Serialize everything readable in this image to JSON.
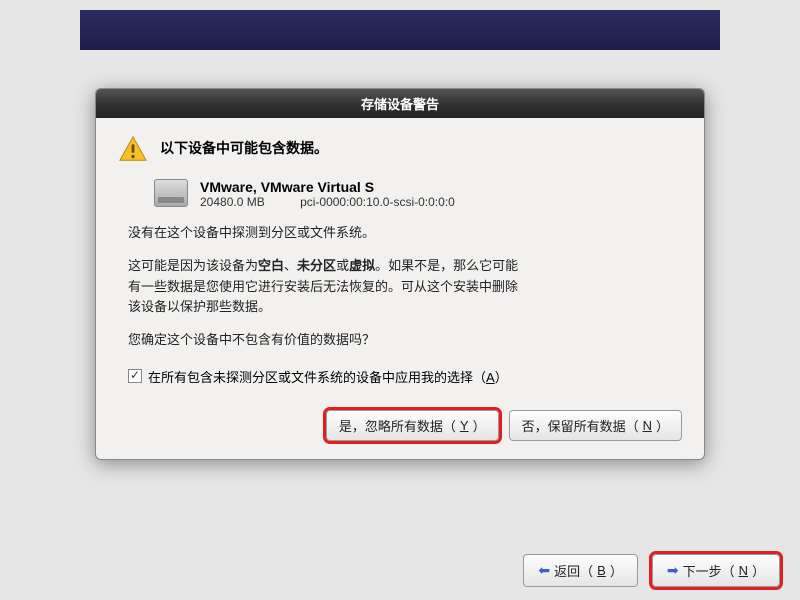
{
  "dialog": {
    "title": "存储设备警告",
    "heading": "以下设备中可能包含数据。",
    "device": {
      "name": "VMware, VMware Virtual S",
      "size": "20480.0 MB",
      "path": "pci-0000:00:10.0-scsi-0:0:0:0"
    },
    "line_no_partition": "没有在这个设备中探测到分区或文件系统。",
    "para_reason_pre": "这可能是因为该设备为",
    "para_reason_b1": "空白",
    "para_reason_sep1": "、",
    "para_reason_b2": "未分区",
    "para_reason_sep2": "或",
    "para_reason_b3": "虚拟",
    "para_reason_post1": "。如果不是，那么它可能",
    "para_reason_line2": "有一些数据是您使用它进行安装后无法恢复的。可从这个安装中删除",
    "para_reason_line3": "该设备以保护那些数据。",
    "confirm_question": "您确定这个设备中不包含有价值的数据吗？",
    "checkbox_label_pre": "在所有包含未探测分区或文件系统的设备中应用我的选择（",
    "checkbox_key": "A",
    "checkbox_label_post": "）",
    "btn_yes_pre": "是，忽略所有数据（",
    "btn_yes_key": "Y",
    "btn_yes_post": "）",
    "btn_no_pre": "否，保留所有数据（",
    "btn_no_key": "N",
    "btn_no_post": "）"
  },
  "nav": {
    "back_pre": "返回（",
    "back_key": "B",
    "back_post": "）",
    "next_pre": "下一步（",
    "next_key": "N",
    "next_post": "）"
  }
}
